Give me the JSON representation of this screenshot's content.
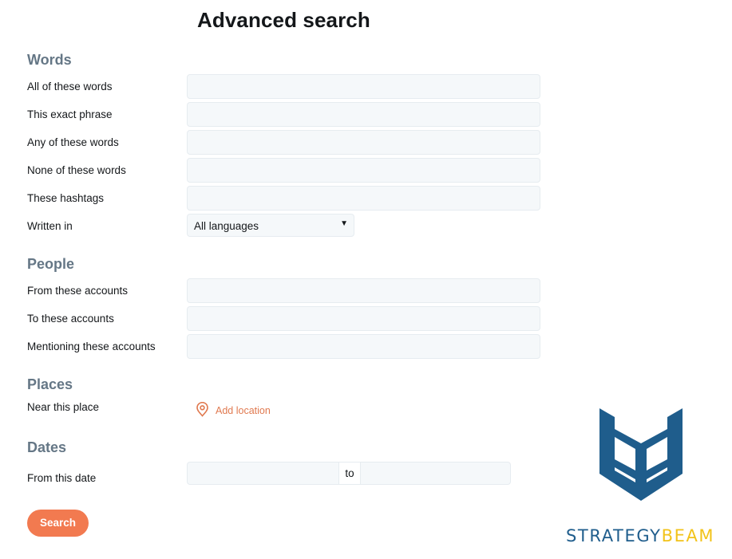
{
  "page": {
    "title": "Advanced search"
  },
  "words": {
    "heading": "Words",
    "fields": [
      {
        "label": "All of these words",
        "value": "",
        "placeholder": ""
      },
      {
        "label": "This exact phrase",
        "value": "",
        "placeholder": ""
      },
      {
        "label": "Any of these words",
        "value": "",
        "placeholder": ""
      },
      {
        "label": "None of these words",
        "value": "",
        "placeholder": ""
      },
      {
        "label": "These hashtags",
        "value": "",
        "placeholder": ""
      }
    ],
    "language": {
      "label": "Written in",
      "selected": "All languages"
    }
  },
  "people": {
    "heading": "People",
    "fields": [
      {
        "label": "From these accounts",
        "value": "",
        "placeholder": ""
      },
      {
        "label": "To these accounts",
        "value": "",
        "placeholder": ""
      },
      {
        "label": "Mentioning these accounts",
        "value": "",
        "placeholder": ""
      }
    ]
  },
  "places": {
    "heading": "Places",
    "near_label": "Near this place",
    "add_location_label": "Add location",
    "icon": "map-pin-icon"
  },
  "dates": {
    "heading": "Dates",
    "from_label": "From this date",
    "separator": "to",
    "from_value": "",
    "to_value": ""
  },
  "search_button": {
    "label": "Search"
  },
  "branding": {
    "logo_icon": "strategybeam-logo-icon",
    "name_part1": "STRATEGY",
    "name_part2": "BEAM",
    "colors": {
      "primary": "#1f5d8c",
      "secondary": "#f2c31a"
    }
  },
  "theme": {
    "accent": "#e0794f",
    "button": "#f27a50",
    "heading": "#657786",
    "input_bg": "#f5f8fa"
  }
}
